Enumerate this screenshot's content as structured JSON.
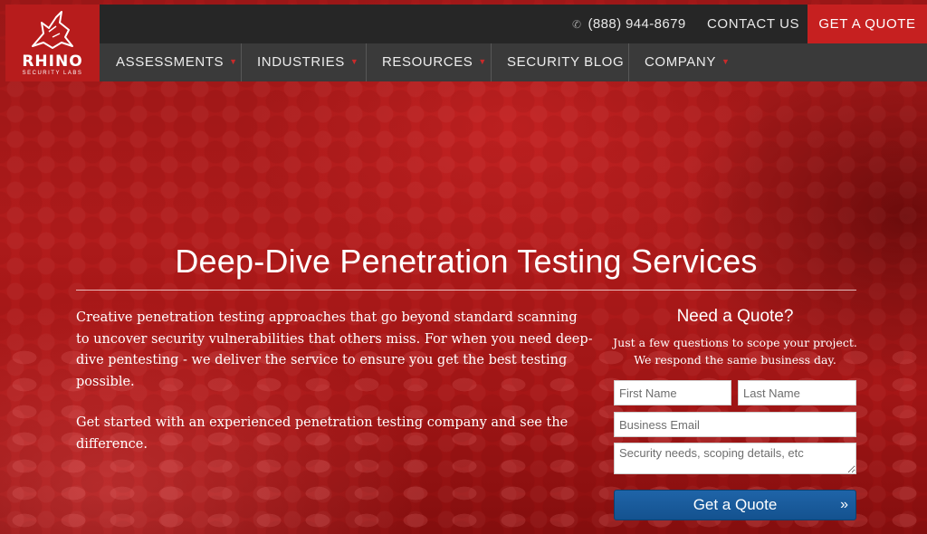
{
  "brand": {
    "name": "RHINO",
    "tagline": "SECURITY LABS"
  },
  "topbar": {
    "phone": "(888) 944-8679",
    "contact": "CONTACT US",
    "quote": "GET A QUOTE"
  },
  "nav": [
    {
      "label": "ASSESSMENTS",
      "dropdown": true
    },
    {
      "label": "INDUSTRIES",
      "dropdown": true
    },
    {
      "label": "RESOURCES",
      "dropdown": true
    },
    {
      "label": "SECURITY BLOG",
      "dropdown": false
    },
    {
      "label": "COMPANY",
      "dropdown": true
    }
  ],
  "hero": {
    "title": "Deep-Dive Penetration Testing Services",
    "paragraph1": "Creative penetration testing approaches that go beyond standard scanning to uncover security vulnerabilities that others miss. For when you need deep-dive pentesting - we deliver the service to ensure you get the best testing possible.",
    "paragraph2": "Get started with an experienced penetration testing company and see the difference."
  },
  "form": {
    "title": "Need a Quote?",
    "subtitle": "Just a few questions to scope your project. We respond the same business day.",
    "first_name_placeholder": "First Name",
    "last_name_placeholder": "Last Name",
    "email_placeholder": "Business Email",
    "needs_placeholder": "Security needs, scoping details, etc",
    "submit_label": "Get a Quote"
  },
  "icons": {
    "phone": "phone-icon",
    "dropdown": "chevron-down-icon",
    "submit": "double-chevron-right-icon"
  },
  "colors": {
    "accent": "#c62020",
    "topbar": "#262626",
    "navbar": "#3a3a3a",
    "button": "#1f64a8"
  }
}
